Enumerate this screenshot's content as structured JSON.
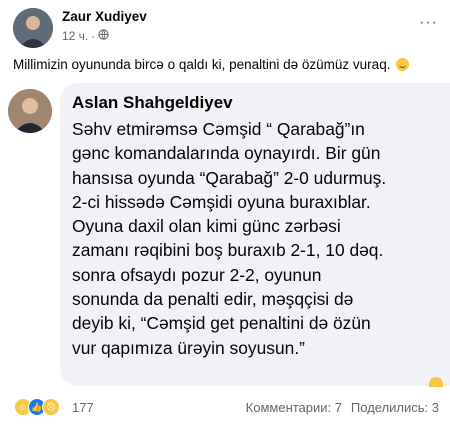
{
  "post": {
    "author": "Zaur Xudiyev",
    "time": "12 ч.",
    "separator": "·",
    "text": "Millimizin oyununda bircə o qaldı ki, penaltini də özümüz vuraq.",
    "more_label": "···"
  },
  "shared_card": {
    "author": "Aslan Shahgeldiyev",
    "lines": [
      "Səhv etmirəmsə Cəmşid “ Qarabağ”ın",
      "gənc komandalarında oynayırdı. Bir gün",
      "hansısa oyunda “Qarabağ” 2-0 udurmuş.",
      "2-ci hissədə Cəmşidi oyuna buraxıblar.",
      "Oyuna daxil olan  kimi günc zərbəsi",
      "zamanı rəqibini boş buraxıb  2-1, 10 dəq.",
      "sonra ofsaydı pozur 2-2, oyunun",
      "sonunda da penalti edir, məşqçisi də",
      "deyib ki, “Cəmşid get penaltini də özün",
      "vur qapımıza ürəyin soyusun.”"
    ]
  },
  "footer": {
    "reaction_count": "177",
    "comments": "Комментарии: 7",
    "shares": "Поделились: 3"
  }
}
